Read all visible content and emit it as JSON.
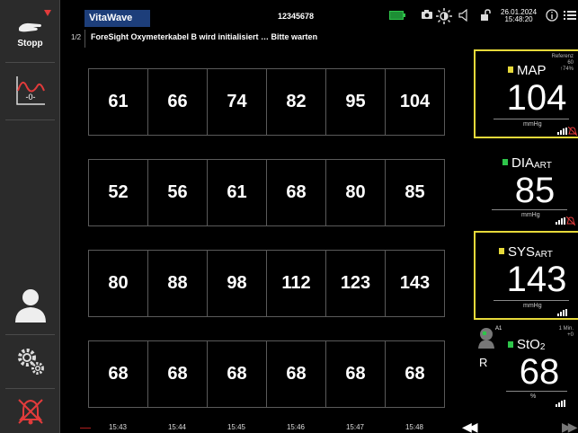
{
  "colors": {
    "flag_yellow": "#e6d93a",
    "flag_green": "#2ec54a",
    "selected_border": "#e6d93a",
    "header_blue": "#1d3e7a",
    "alarm_red": "#e23b3b"
  },
  "sidebar": {
    "stop_label": "Stopp",
    "trend_glyph": "-0-",
    "icons": [
      "stop-hand-icon",
      "trend-icon",
      "patient-icon",
      "settings-gears-icon",
      "alarm-bell-icon"
    ]
  },
  "header": {
    "app_name": "VitaWave",
    "patient_id": "12345678",
    "date": "26.01.2024",
    "time": "15:48:20",
    "icons": [
      "battery-icon",
      "camera-icon",
      "brightness-icon",
      "volume-icon",
      "lock-icon",
      "info-icon",
      "menu-icon"
    ]
  },
  "message_bar": {
    "page": "1/2",
    "message": "ForeSight Oxymeterkabel B wird initialisiert … Bitte warten"
  },
  "table": {
    "rows": [
      [
        "61",
        "66",
        "74",
        "82",
        "95",
        "104"
      ],
      [
        "52",
        "56",
        "61",
        "68",
        "80",
        "85"
      ],
      [
        "80",
        "88",
        "98",
        "112",
        "123",
        "143"
      ],
      [
        "68",
        "68",
        "68",
        "68",
        "68",
        "68"
      ]
    ],
    "times": [
      "15:43",
      "15:44",
      "15:45",
      "15:46",
      "15:47",
      "15:48"
    ]
  },
  "tiles": {
    "map": {
      "name": "MAP",
      "value": "104",
      "unit": "mmHg",
      "ref_label": "Referenz",
      "ref_value": "60",
      "ref_delta": "↑74%",
      "flag": "yellow"
    },
    "dia": {
      "name": "DIA",
      "sub": "ART",
      "value": "85",
      "unit": "mmHg",
      "flag": "green"
    },
    "sys": {
      "name": "SYS",
      "sub": "ART",
      "value": "143",
      "unit": "mmHg",
      "flag": "yellow"
    },
    "sto2": {
      "name": "StO",
      "sub": "2",
      "value": "68",
      "unit": "%",
      "channel": "A1",
      "side": "R",
      "interval": "1 Min.",
      "delta": "+0",
      "flag": "green"
    }
  }
}
